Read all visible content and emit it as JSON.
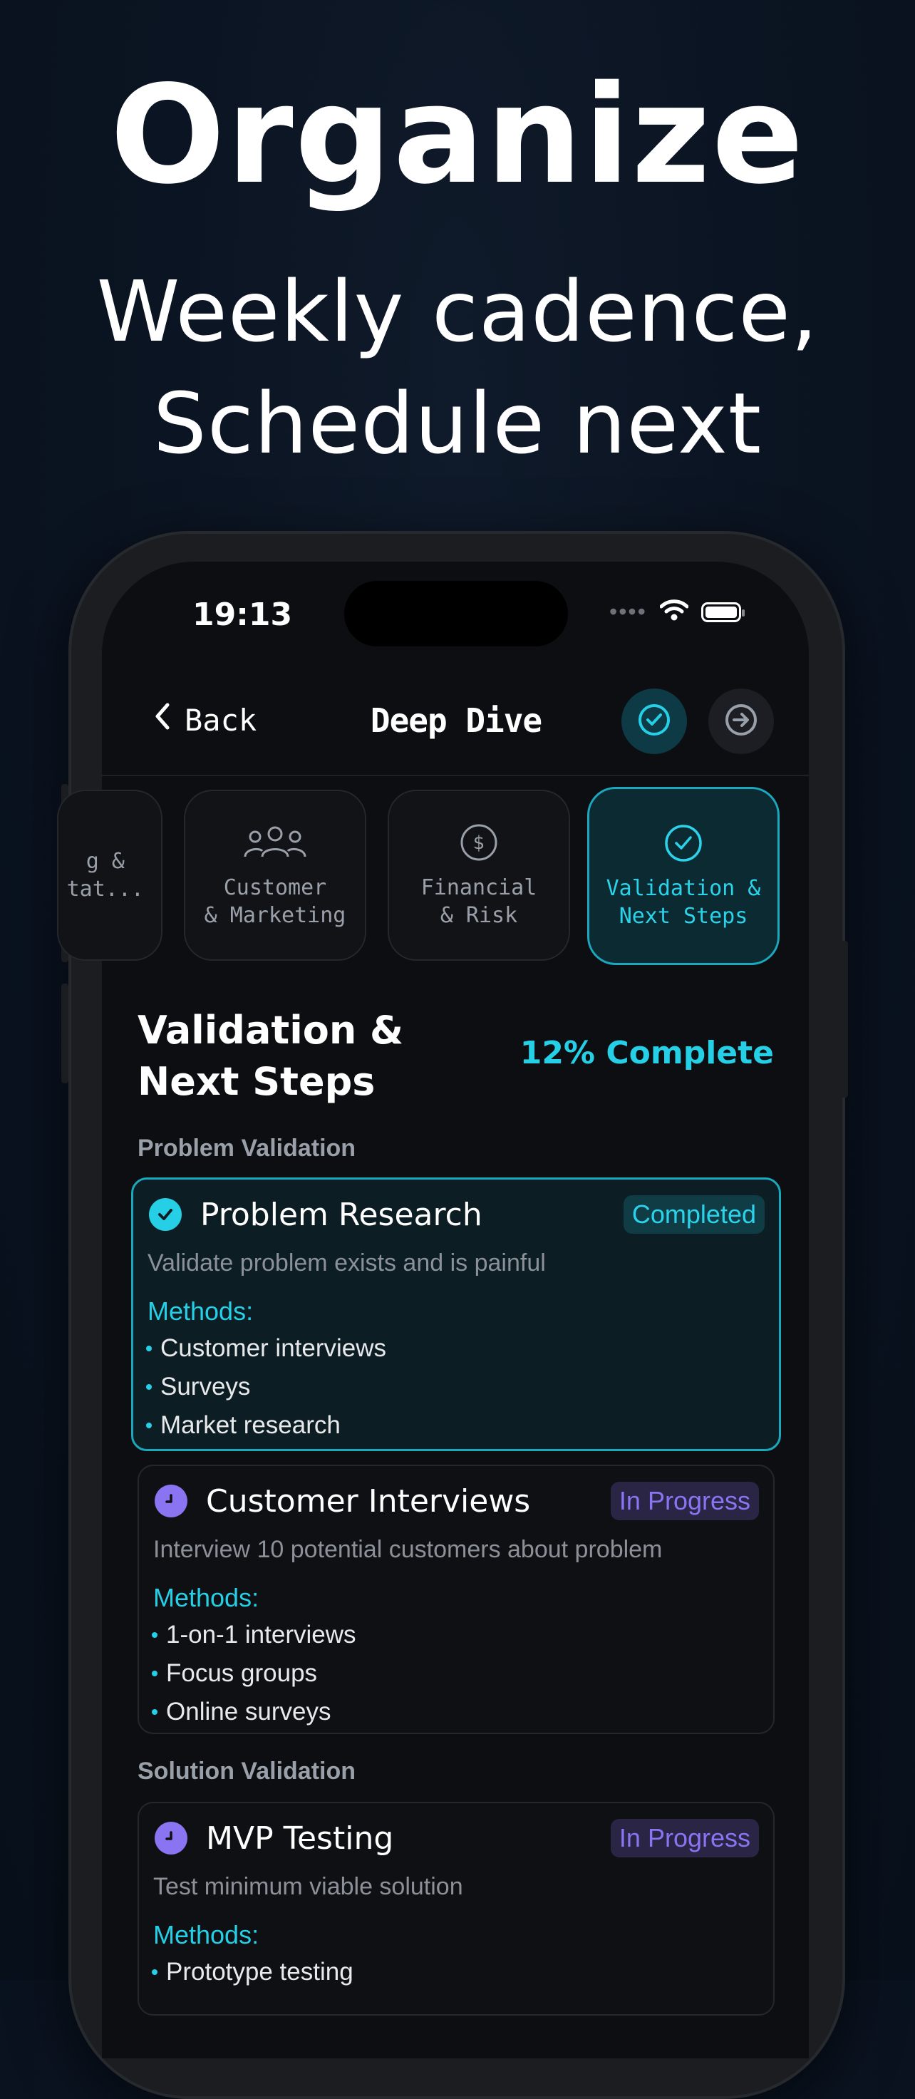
{
  "hero": {
    "title": "Organize",
    "subtitle_line1": "Weekly cadence,",
    "subtitle_line2": "Schedule next"
  },
  "status_bar": {
    "time": "19:13",
    "icons": [
      "cellular-dots-icon",
      "wifi-icon",
      "battery-icon"
    ]
  },
  "nav": {
    "back_label": "Back",
    "title": "Deep Dive",
    "right_icons": [
      "check-circle-icon",
      "arrow-right-circle-icon"
    ]
  },
  "tabs": [
    {
      "label": "g &\ntat...",
      "icon": "",
      "state": "partial"
    },
    {
      "label": "Customer\n& Marketing",
      "icon": "users-icon",
      "state": "normal"
    },
    {
      "label": "Financial\n& Risk",
      "icon": "dollar-circle-icon",
      "state": "normal"
    },
    {
      "label": "Validation &\nNext Steps",
      "icon": "check-circle-icon",
      "state": "selected"
    }
  ],
  "section": {
    "title_line1": "Validation &",
    "title_line2": "Next Steps",
    "progress_text": "12% Complete"
  },
  "groups": [
    {
      "label": "Problem Validation"
    },
    {
      "label": "Solution Validation"
    }
  ],
  "cards": [
    {
      "title": "Problem Research",
      "status": "Completed",
      "description": "Validate problem exists and is painful",
      "methods_label": "Methods:",
      "methods": [
        "Customer interviews",
        "Surveys",
        "Market research"
      ]
    },
    {
      "title": "Customer Interviews",
      "status": "In Progress",
      "description": "Interview 10 potential customers about problem",
      "methods_label": "Methods:",
      "methods": [
        "1-on-1 interviews",
        "Focus groups",
        "Online surveys"
      ]
    },
    {
      "title": "MVP Testing",
      "status": "In Progress",
      "description": "Test minimum viable solution",
      "methods_label": "Methods:",
      "methods": [
        "Prototype testing"
      ]
    }
  ],
  "colors": {
    "accent": "#25cfe6",
    "progress": "#8a74f2",
    "background": "#0d0e11"
  }
}
